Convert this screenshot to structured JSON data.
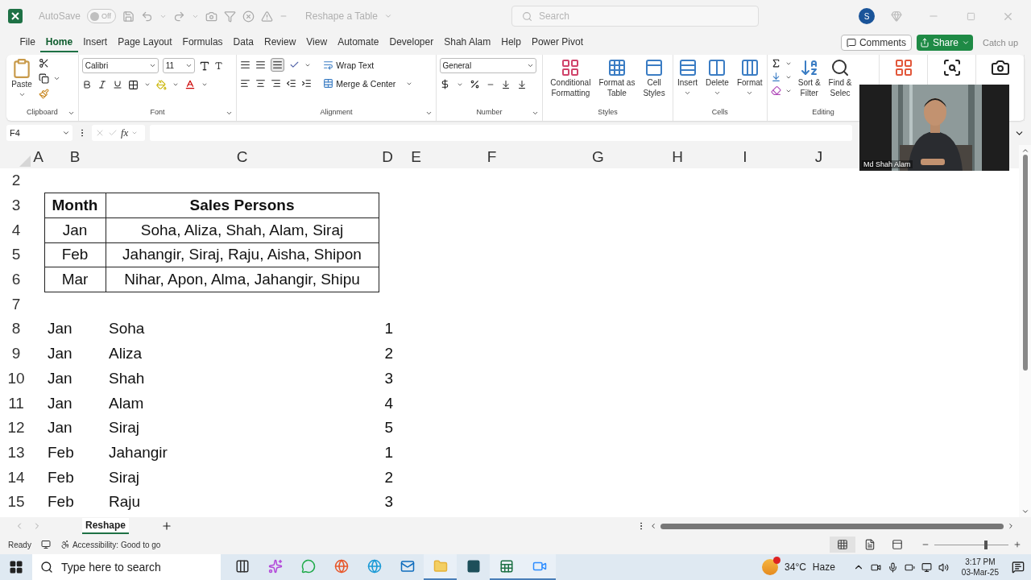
{
  "title_bar": {
    "autosave_label": "AutoSave",
    "autosave": {
      "on": false,
      "label": "Off"
    },
    "document_title": "Reshape a Table",
    "search_placeholder": "Search",
    "avatar": "S"
  },
  "menu_tabs": [
    {
      "label": "File",
      "selected": false
    },
    {
      "label": "Home",
      "selected": true
    },
    {
      "label": "Insert",
      "selected": false
    },
    {
      "label": "Page Layout",
      "selected": false
    },
    {
      "label": "Formulas",
      "selected": false
    },
    {
      "label": "Data",
      "selected": false
    },
    {
      "label": "Review",
      "selected": false
    },
    {
      "label": "View",
      "selected": false
    },
    {
      "label": "Automate",
      "selected": false
    },
    {
      "label": "Developer",
      "selected": false
    },
    {
      "label": "Shah Alam",
      "selected": false
    },
    {
      "label": "Help",
      "selected": false
    },
    {
      "label": "Power Pivot",
      "selected": false
    }
  ],
  "actions": {
    "comments": "Comments",
    "share": "Share",
    "catch_up": {
      "label": "Catch up",
      "disabled": true
    }
  },
  "ribbon": {
    "clipboard": {
      "paste": "Paste",
      "label": "Clipboard"
    },
    "font": {
      "name": "Calibri",
      "size": "11",
      "label": "Font"
    },
    "alignment": {
      "wrap_text": "Wrap Text",
      "merge_center": "Merge & Center",
      "label": "Alignment"
    },
    "number": {
      "format": "General",
      "label": "Number"
    },
    "styles": {
      "label": "Styles",
      "buttons": [
        {
          "kind": "conditional",
          "lines": [
            "Conditional",
            "Formatting"
          ]
        },
        {
          "kind": "table",
          "lines": [
            "Format as",
            "Table"
          ]
        },
        {
          "kind": "cellstyle",
          "lines": [
            "Cell",
            "Styles"
          ]
        }
      ]
    },
    "cells": {
      "label": "Cells",
      "buttons": [
        {
          "kind": "insert",
          "lines": [
            "Insert"
          ]
        },
        {
          "kind": "delete",
          "lines": [
            "Delete"
          ]
        },
        {
          "kind": "format",
          "lines": [
            "Format"
          ]
        }
      ]
    },
    "editing": {
      "label": "Editing",
      "sort_filter": [
        "Sort &",
        "Filter"
      ],
      "find_select": [
        "Find &",
        "Selec"
      ]
    }
  },
  "formula_bar": {
    "name_box": "F4",
    "fx": "fx"
  },
  "columns": [
    "A",
    "B",
    "C",
    "D",
    "E",
    "F",
    "G",
    "H",
    "I",
    "J"
  ],
  "rows": [
    {
      "number": "2",
      "kind": "blank"
    },
    {
      "number": "3",
      "kind": "table_header",
      "month": "Month",
      "names": "Sales Persons"
    },
    {
      "number": "4",
      "kind": "table_row",
      "month": "Jan",
      "names": "Soha, Aliza, Shah, Alam, Siraj"
    },
    {
      "number": "5",
      "kind": "table_row",
      "month": "Feb",
      "names": "Jahangir, Siraj, Raju, Aisha, Shipon"
    },
    {
      "number": "6",
      "kind": "table_row",
      "month": "Mar",
      "names": "Nihar, Apon, Alma, Jahangir, Shipu"
    },
    {
      "number": "7",
      "kind": "blank"
    },
    {
      "number": "8",
      "kind": "list",
      "month": "Jan",
      "name": "Soha",
      "index": "1"
    },
    {
      "number": "9",
      "kind": "list",
      "month": "Jan",
      "name": "Aliza",
      "index": "2"
    },
    {
      "number": "10",
      "kind": "list",
      "month": "Jan",
      "name": "Shah",
      "index": "3"
    },
    {
      "number": "11",
      "kind": "list",
      "month": "Jan",
      "name": "Alam",
      "index": "4"
    },
    {
      "number": "12",
      "kind": "list",
      "month": "Jan",
      "name": "Siraj",
      "index": "5"
    },
    {
      "number": "13",
      "kind": "list",
      "month": "Feb",
      "name": "Jahangir",
      "index": "1"
    },
    {
      "number": "14",
      "kind": "list",
      "month": "Feb",
      "name": "Siraj",
      "index": "2"
    },
    {
      "number": "15",
      "kind": "list",
      "month": "Feb",
      "name": "Raju",
      "index": "3"
    }
  ],
  "sheet_tabs": [
    {
      "label": "Reshape",
      "selected": true
    }
  ],
  "status_bar": {
    "ready": "Ready",
    "accessibility": "Accessibility: Good to go",
    "views": [
      {
        "kind": "normal",
        "selected": true
      },
      {
        "kind": "page_layout",
        "selected": false
      },
      {
        "kind": "page_break",
        "selected": false
      }
    ],
    "zoom": {
      "level": 0.67
    }
  },
  "webcam": {
    "name": "Md Shah Alam"
  },
  "taskbar": {
    "search_placeholder": "Type here to search",
    "apps": [
      {
        "kind": "task_view",
        "active": false
      },
      {
        "kind": "copilot",
        "active": false
      },
      {
        "kind": "chat",
        "active": false
      },
      {
        "kind": "browser_fox",
        "active": false
      },
      {
        "kind": "browser_edge",
        "active": false
      },
      {
        "kind": "mail",
        "active": false
      },
      {
        "kind": "folder",
        "active": true
      },
      {
        "kind": "dark_app",
        "active": false
      },
      {
        "kind": "spreadsheet",
        "active": true
      },
      {
        "kind": "video",
        "active": true
      }
    ],
    "temperature": "34°C",
    "weather": "Haze",
    "time": "3:17 PM",
    "date": "03-Mar-25"
  }
}
